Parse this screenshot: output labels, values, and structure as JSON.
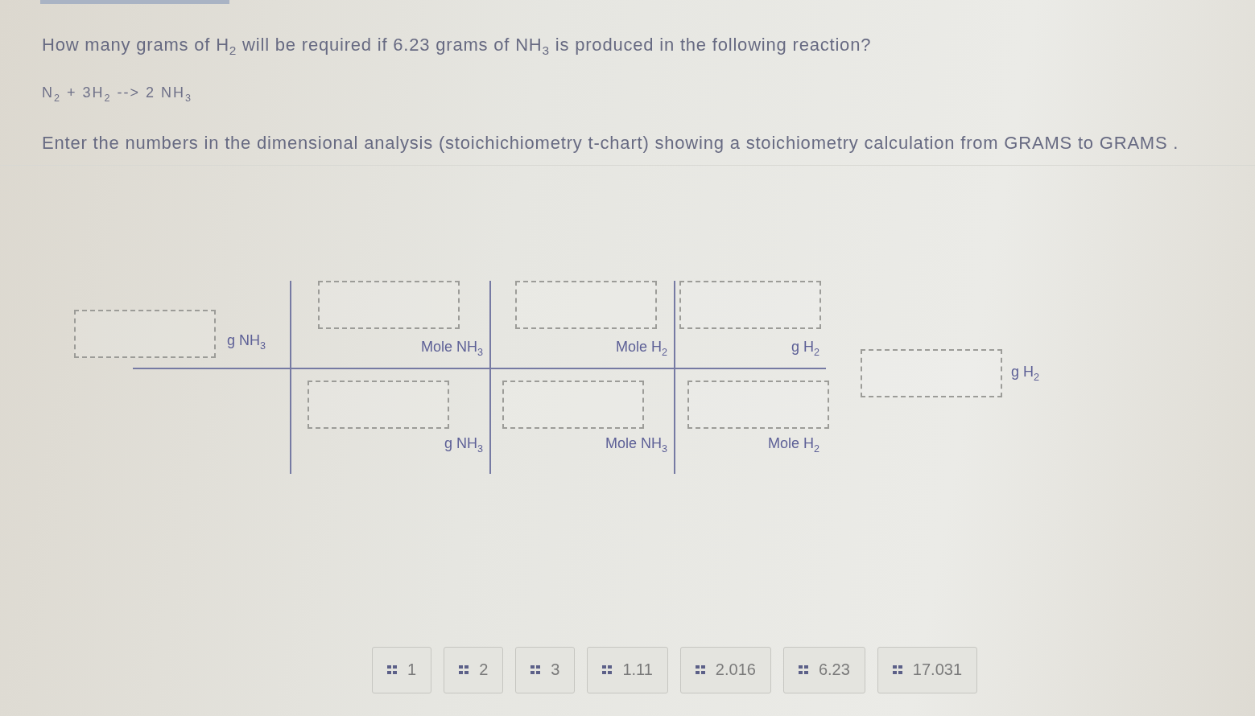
{
  "question": "How many grams of H$_{2}$ will be required if 6.23 grams of NH$_{3}$ is produced in the following reaction?",
  "equation": "N$_{2}$ + 3H$_{2}$ --> 2 NH$_{3}$",
  "instruction": "Enter the numbers in the dimensional analysis (stoichichiometry t-chart) showing a stoichiometry calculation from GRAMS to GRAMS .",
  "t_chart": {
    "given_unit": "g NH$_{3}$",
    "factors": [
      {
        "numerator_unit": "Mole NH$_{3}$",
        "denominator_unit": "g NH$_{3}$"
      },
      {
        "numerator_unit": "Mole H$_{2}$",
        "denominator_unit": "Mole NH$_{3}$"
      },
      {
        "numerator_unit": "g H$_{2}$",
        "denominator_unit": "Mole H$_{2}$"
      }
    ],
    "answer_unit": "g H$_{2}$"
  },
  "answer_choices": [
    "1",
    "2",
    "3",
    "1.11",
    "2.016",
    "6.23",
    "17.031"
  ]
}
